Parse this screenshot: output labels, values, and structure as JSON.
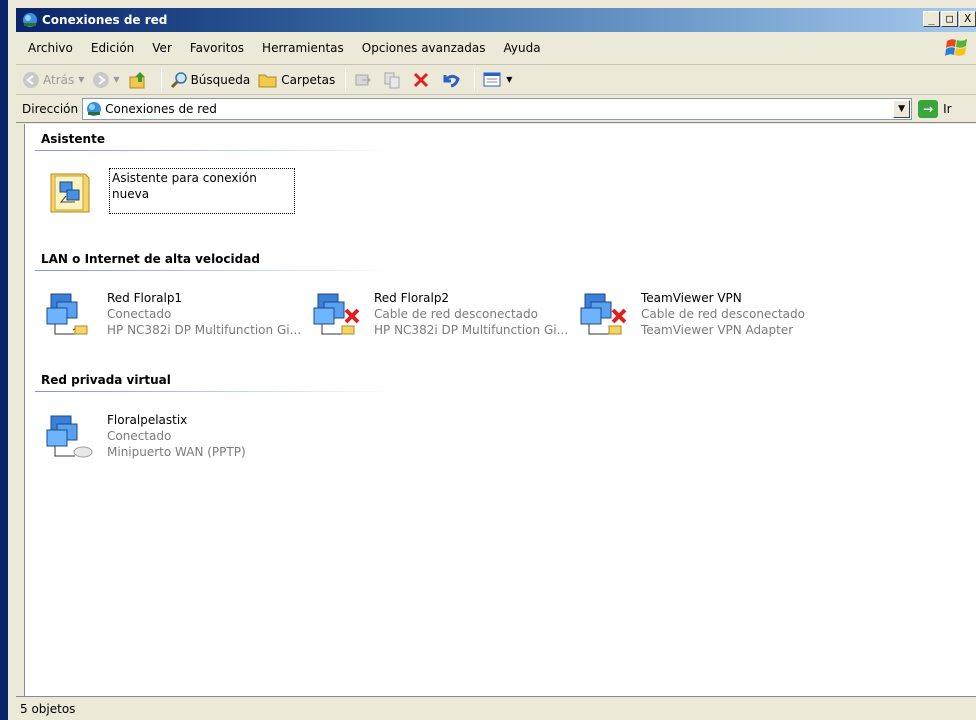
{
  "window": {
    "title": "Conexiones de red",
    "controls": [
      "_",
      "□",
      "X"
    ]
  },
  "menu": [
    {
      "label": "Archivo"
    },
    {
      "label": "Edición"
    },
    {
      "label": "Ver"
    },
    {
      "label": "Favoritos"
    },
    {
      "label": "Herramientas"
    },
    {
      "label": "Opciones avanzadas"
    },
    {
      "label": "Ayuda"
    }
  ],
  "toolbar": {
    "back_label": "Atrás",
    "search_label": "Búsqueda",
    "folders_label": "Carpetas"
  },
  "address": {
    "label": "Dirección",
    "value": "Conexiones de red",
    "go_label": "Ir"
  },
  "groups": {
    "wizard": {
      "header": "Asistente",
      "items": [
        {
          "name": "Asistente para conexión nueva",
          "icon": "new-connection-wizard-icon"
        }
      ]
    },
    "lan": {
      "header": "LAN o Internet de alta velocidad",
      "items": [
        {
          "name": "Red Floralp1",
          "status": "Conectado",
          "device": "HP NC382i DP Multifunction Gi...",
          "icon": "lan-connected-icon"
        },
        {
          "name": "Red Floralp2",
          "status": "Cable de red desconectado",
          "device": "HP NC382i DP Multifunction Gi...",
          "icon": "lan-disconnected-icon"
        },
        {
          "name": "TeamViewer VPN",
          "status": "Cable de red desconectado",
          "device": "TeamViewer VPN Adapter",
          "icon": "lan-disconnected-icon"
        }
      ]
    },
    "vpn": {
      "header": "Red privada virtual",
      "items": [
        {
          "name": "Floralpelastix",
          "status": "Conectado",
          "device": "Minipuerto WAN (PPTP)",
          "icon": "vpn-connection-icon"
        }
      ]
    }
  },
  "status": {
    "text": "5 objetos"
  },
  "colors": {
    "titlebar": "#0a246a",
    "chrome": "#ece9d8",
    "disconnect_x": "#e02020"
  }
}
